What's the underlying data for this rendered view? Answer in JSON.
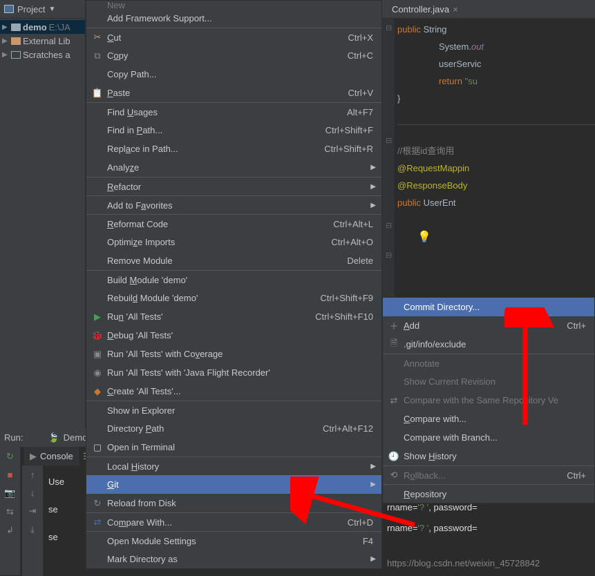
{
  "project": {
    "header": "Project",
    "tree": {
      "demo": "demo",
      "demo_path": "E:\\JA",
      "external": "External Lib",
      "scratches": "Scratches a"
    }
  },
  "editor": {
    "tab": "Controller.java",
    "lines": {
      "l1a": "public ",
      "l1b": "String ",
      "l2a": "System.",
      "l2b": "out",
      "l3": "userServic",
      "l4a": "return ",
      "l4b": "\"su",
      "l5": "}",
      "l6a": "//",
      "l6b": "根据id查询用",
      "l7": "@RequestMappin",
      "l8": "@ResponseBody",
      "l9a": "public ",
      "l9b": "UserEnt"
    }
  },
  "menu": {
    "new": "New",
    "add_fw": "Add Framework Support...",
    "cut": "Cut",
    "cut_key": "Ctrl+X",
    "copy": "Copy",
    "copy_key": "Ctrl+C",
    "copy_path": "Copy Path...",
    "paste": "Paste",
    "paste_key": "Ctrl+V",
    "find_usages": "Find Usages",
    "find_usages_key": "Alt+F7",
    "find_in_path": "Find in Path...",
    "find_in_path_key": "Ctrl+Shift+F",
    "replace_in_path": "Replace in Path...",
    "replace_in_path_key": "Ctrl+Shift+R",
    "analyze": "Analyze",
    "refactor": "Refactor",
    "add_fav": "Add to Favorites",
    "reformat": "Reformat Code",
    "reformat_key": "Ctrl+Alt+L",
    "optimize": "Optimize Imports",
    "optimize_key": "Ctrl+Alt+O",
    "remove_mod": "Remove Module",
    "remove_mod_key": "Delete",
    "build": "Build Module 'demo'",
    "rebuild": "Rebuild Module 'demo'",
    "rebuild_key": "Ctrl+Shift+F9",
    "run": "Run 'All Tests'",
    "run_key": "Ctrl+Shift+F10",
    "debug": "Debug 'All Tests'",
    "coverage": "Run 'All Tests' with Coverage",
    "jfr": "Run 'All Tests' with 'Java Flight Recorder'",
    "create": "Create 'All Tests'...",
    "show_explorer": "Show in Explorer",
    "dir_path": "Directory Path",
    "dir_path_key": "Ctrl+Alt+F12",
    "open_term": "Open in Terminal",
    "local_history": "Local History",
    "git": "Git",
    "reload": "Reload from Disk",
    "compare_with": "Compare With...",
    "compare_with_key": "Ctrl+D",
    "open_mod": "Open Module Settings",
    "open_mod_key": "F4",
    "mark_dir": "Mark Directory as"
  },
  "submenu": {
    "commit": "Commit Directory...",
    "add": "Add",
    "add_key": "Ctrl+",
    "exclude": ".git/info/exclude",
    "annotate": "Annotate",
    "show_rev": "Show Current Revision",
    "compare_repo": "Compare with the Same Repository Ve",
    "compare_with": "Compare with...",
    "compare_branch": "Compare with Branch...",
    "show_hist": "Show History",
    "rollback": "Rollback...",
    "rollback_key": "Ctrl+",
    "repository": "Repository"
  },
  "run_panel": {
    "label": "Run:",
    "config": "Demo",
    "console_tab": "Console",
    "console_lines": {
      "l1": "Use",
      "l2": "se",
      "l3": "se"
    }
  },
  "lower_code": {
    "l1a": "rname=",
    "l1b": "'? '",
    "l1c": ", password=",
    "l2a": "rname=",
    "l2b": "'? '",
    "l2c": ", password="
  },
  "watermark": "https://blog.csdn.net/weixin_45728842"
}
